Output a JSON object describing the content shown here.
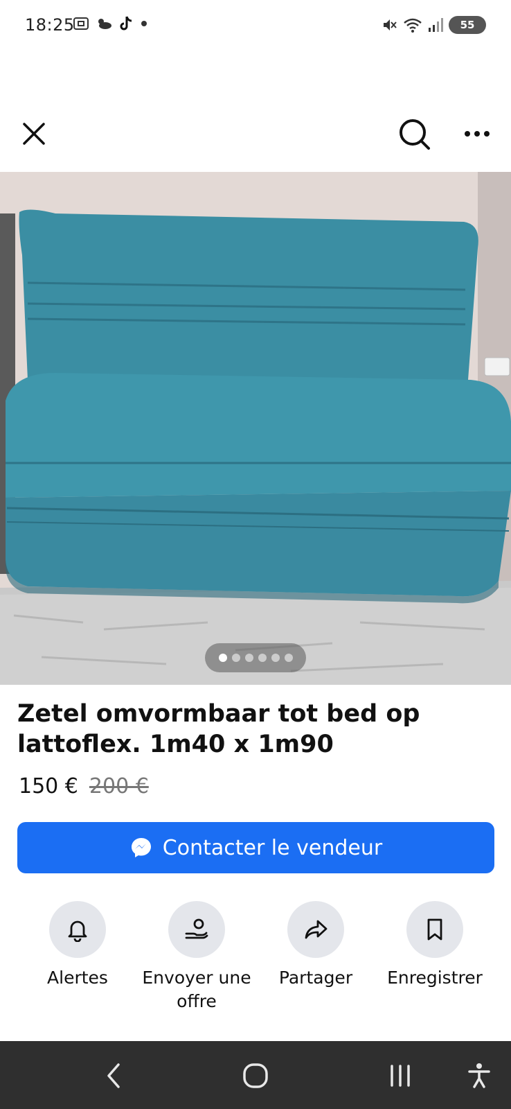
{
  "status_bar": {
    "time": "18:25",
    "battery": "55"
  },
  "app_bar": {
    "close_icon": "close-icon",
    "search_icon": "search-icon",
    "more_icon": "more-icon"
  },
  "gallery": {
    "image_count": 6,
    "active_index": 0
  },
  "listing": {
    "title": "Zetel omvormbaar tot bed op lattoflex. 1m40 x 1m90",
    "price": "150 €",
    "old_price": "200 €"
  },
  "contact_button": {
    "label": "Contacter le vendeur",
    "icon": "messenger-icon",
    "color": "#1b6ef3"
  },
  "actions": [
    {
      "label": "Alertes",
      "icon": "bell-icon"
    },
    {
      "label": "Envoyer une offre",
      "icon": "offer-icon"
    },
    {
      "label": "Partager",
      "icon": "share-icon"
    },
    {
      "label": "Enregistrer",
      "icon": "bookmark-icon"
    }
  ],
  "nav": {
    "back_icon": "back-icon",
    "home_icon": "home-icon",
    "recents_icon": "recents-icon",
    "accessibility_icon": "accessibility-icon"
  }
}
